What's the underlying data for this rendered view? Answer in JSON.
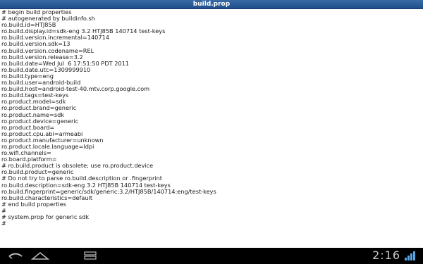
{
  "window": {
    "title": "build.prop"
  },
  "file": {
    "lines": [
      "# begin build properties",
      "# autogenerated by buildinfo.sh",
      "ro.build.id=HTJ85B",
      "ro.build.display.id=sdk-eng 3.2 HTJ85B 140714 test-keys",
      "ro.build.version.incremental=140714",
      "ro.build.version.sdk=13",
      "ro.build.version.codename=REL",
      "ro.build.version.release=3.2",
      "ro.build.date=Wed Jul  6 17:51:50 PDT 2011",
      "ro.build.date.utc=1309999910",
      "ro.build.type=eng",
      "ro.build.user=android-build",
      "ro.build.host=android-test-40.mtv.corp.google.com",
      "ro.build.tags=test-keys",
      "ro.product.model=sdk",
      "ro.product.brand=generic",
      "ro.product.name=sdk",
      "ro.product.device=generic",
      "ro.product.board=",
      "ro.product.cpu.abi=armeabi",
      "ro.product.manufacturer=unknown",
      "ro.product.locale.language=ldpi",
      "ro.wifi.channels=",
      "ro.board.platform=",
      "# ro.build.product is obsolete; use ro.product.device",
      "ro.build.product=generic",
      "# Do not try to parse ro.build.description or .fingerprint",
      "ro.build.description=sdk-eng 3.2 HTJ85B 140714 test-keys",
      "ro.build.fingerprint=generic/sdk/generic:3.2/HTJ85B/140714:eng/test-keys",
      "ro.build.characteristics=default",
      "# end build properties",
      "#",
      "# system.prop for generic sdk",
      "#"
    ]
  },
  "navbar": {
    "back_icon": "back-arrow-icon",
    "home_icon": "home-icon",
    "recent_icon": "recent-apps-icon",
    "time": "2:16",
    "signal_icon": "signal-strength-icon"
  },
  "colors": {
    "title_bar": "#2a5a96",
    "navbar": "#000000",
    "signal": "#5aa6e6"
  }
}
